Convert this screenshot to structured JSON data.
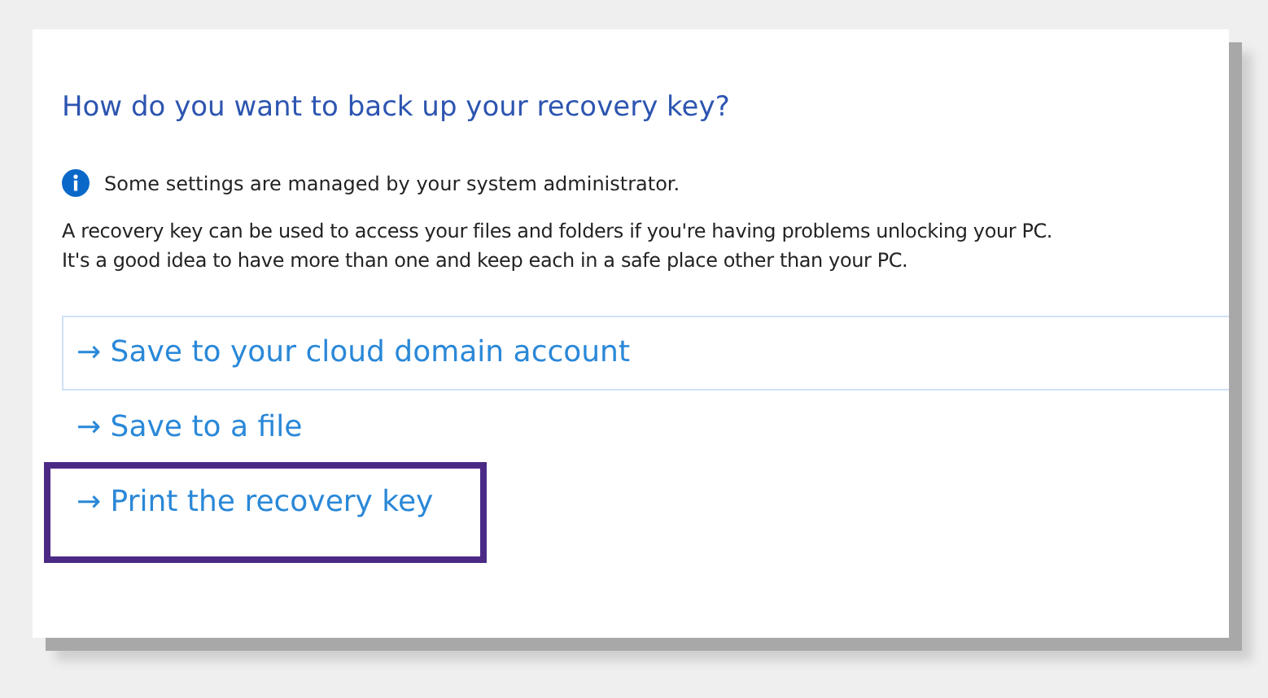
{
  "title": "How do you want to back up your recovery key?",
  "notice": "Some settings are managed by your system administrator.",
  "description": [
    "A recovery key can be used to access your files and folders if you're having problems unlocking your PC.",
    "It's a good idea to have more than one and keep each in a safe place other than your PC."
  ],
  "options": [
    {
      "arrow": "→",
      "label": "Save to your cloud domain account",
      "focused": true,
      "highlighted": false
    },
    {
      "arrow": "→",
      "label": "Save to a file",
      "focused": false,
      "highlighted": false
    },
    {
      "arrow": "→",
      "label": "Print the recovery key",
      "focused": false,
      "highlighted": true
    }
  ]
}
